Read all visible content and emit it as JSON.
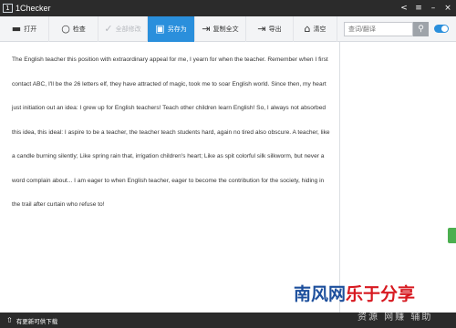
{
  "window": {
    "logo_text": "1",
    "title": "1Checker",
    "controls": [
      "<",
      "≡",
      "–",
      "×"
    ]
  },
  "toolbar": {
    "buttons": [
      {
        "icon": "folder-icon",
        "glyph": "▬",
        "label": "打开"
      },
      {
        "icon": "search-icon",
        "glyph": "○",
        "label": "检查"
      },
      {
        "icon": "check-all-icon",
        "glyph": "✓",
        "label": "全部修改"
      },
      {
        "icon": "save-as-icon",
        "glyph": "▣",
        "label": "另存为"
      },
      {
        "icon": "copy-text-icon",
        "glyph": "⇥",
        "label": "复制全文"
      },
      {
        "icon": "export-icon",
        "glyph": "⇥",
        "label": "导出"
      },
      {
        "icon": "clear-icon",
        "glyph": "⌂",
        "label": "清空"
      }
    ]
  },
  "search": {
    "placeholder": "查词/翻译",
    "button_glyph": "⚲"
  },
  "document": {
    "text": "The English teacher this position with extraordinary appeal for me, I yearn for when the teacher. Remember when I first contact ABC, I'll be the 26 letters elf, they have attracted of magic, took me to soar English world. Since then, my heart just initiation out an idea: I grew up for English teachers! Teach other children learn English! So, I always not absorbed this idea, this ideal: I aspire to be a teacher, the teacher teach students hard, again no tired also obscure. A teacher, like a candle burning silently; Like spring rain that, irrigation children's heart; Like as spit colorful silk silkworm, but never a word complain about... I am eager to when English teacher, eager to become the contribution for the society, hiding in the trail after curtain who refuse to!"
  },
  "statusbar": {
    "arrow": "⇧",
    "text": "有更新可供下载"
  },
  "watermark": {
    "main_part1": "南风网",
    "main_part2": "乐于分享",
    "sub": "资源 网赚 辅助"
  },
  "colors": {
    "titlebar": "#2b2b2b",
    "accent": "#2a8fdc",
    "toolbar_bg": "#f3f4f6",
    "watermark_red": "#d71920",
    "watermark_blue": "#1d4f9c"
  }
}
